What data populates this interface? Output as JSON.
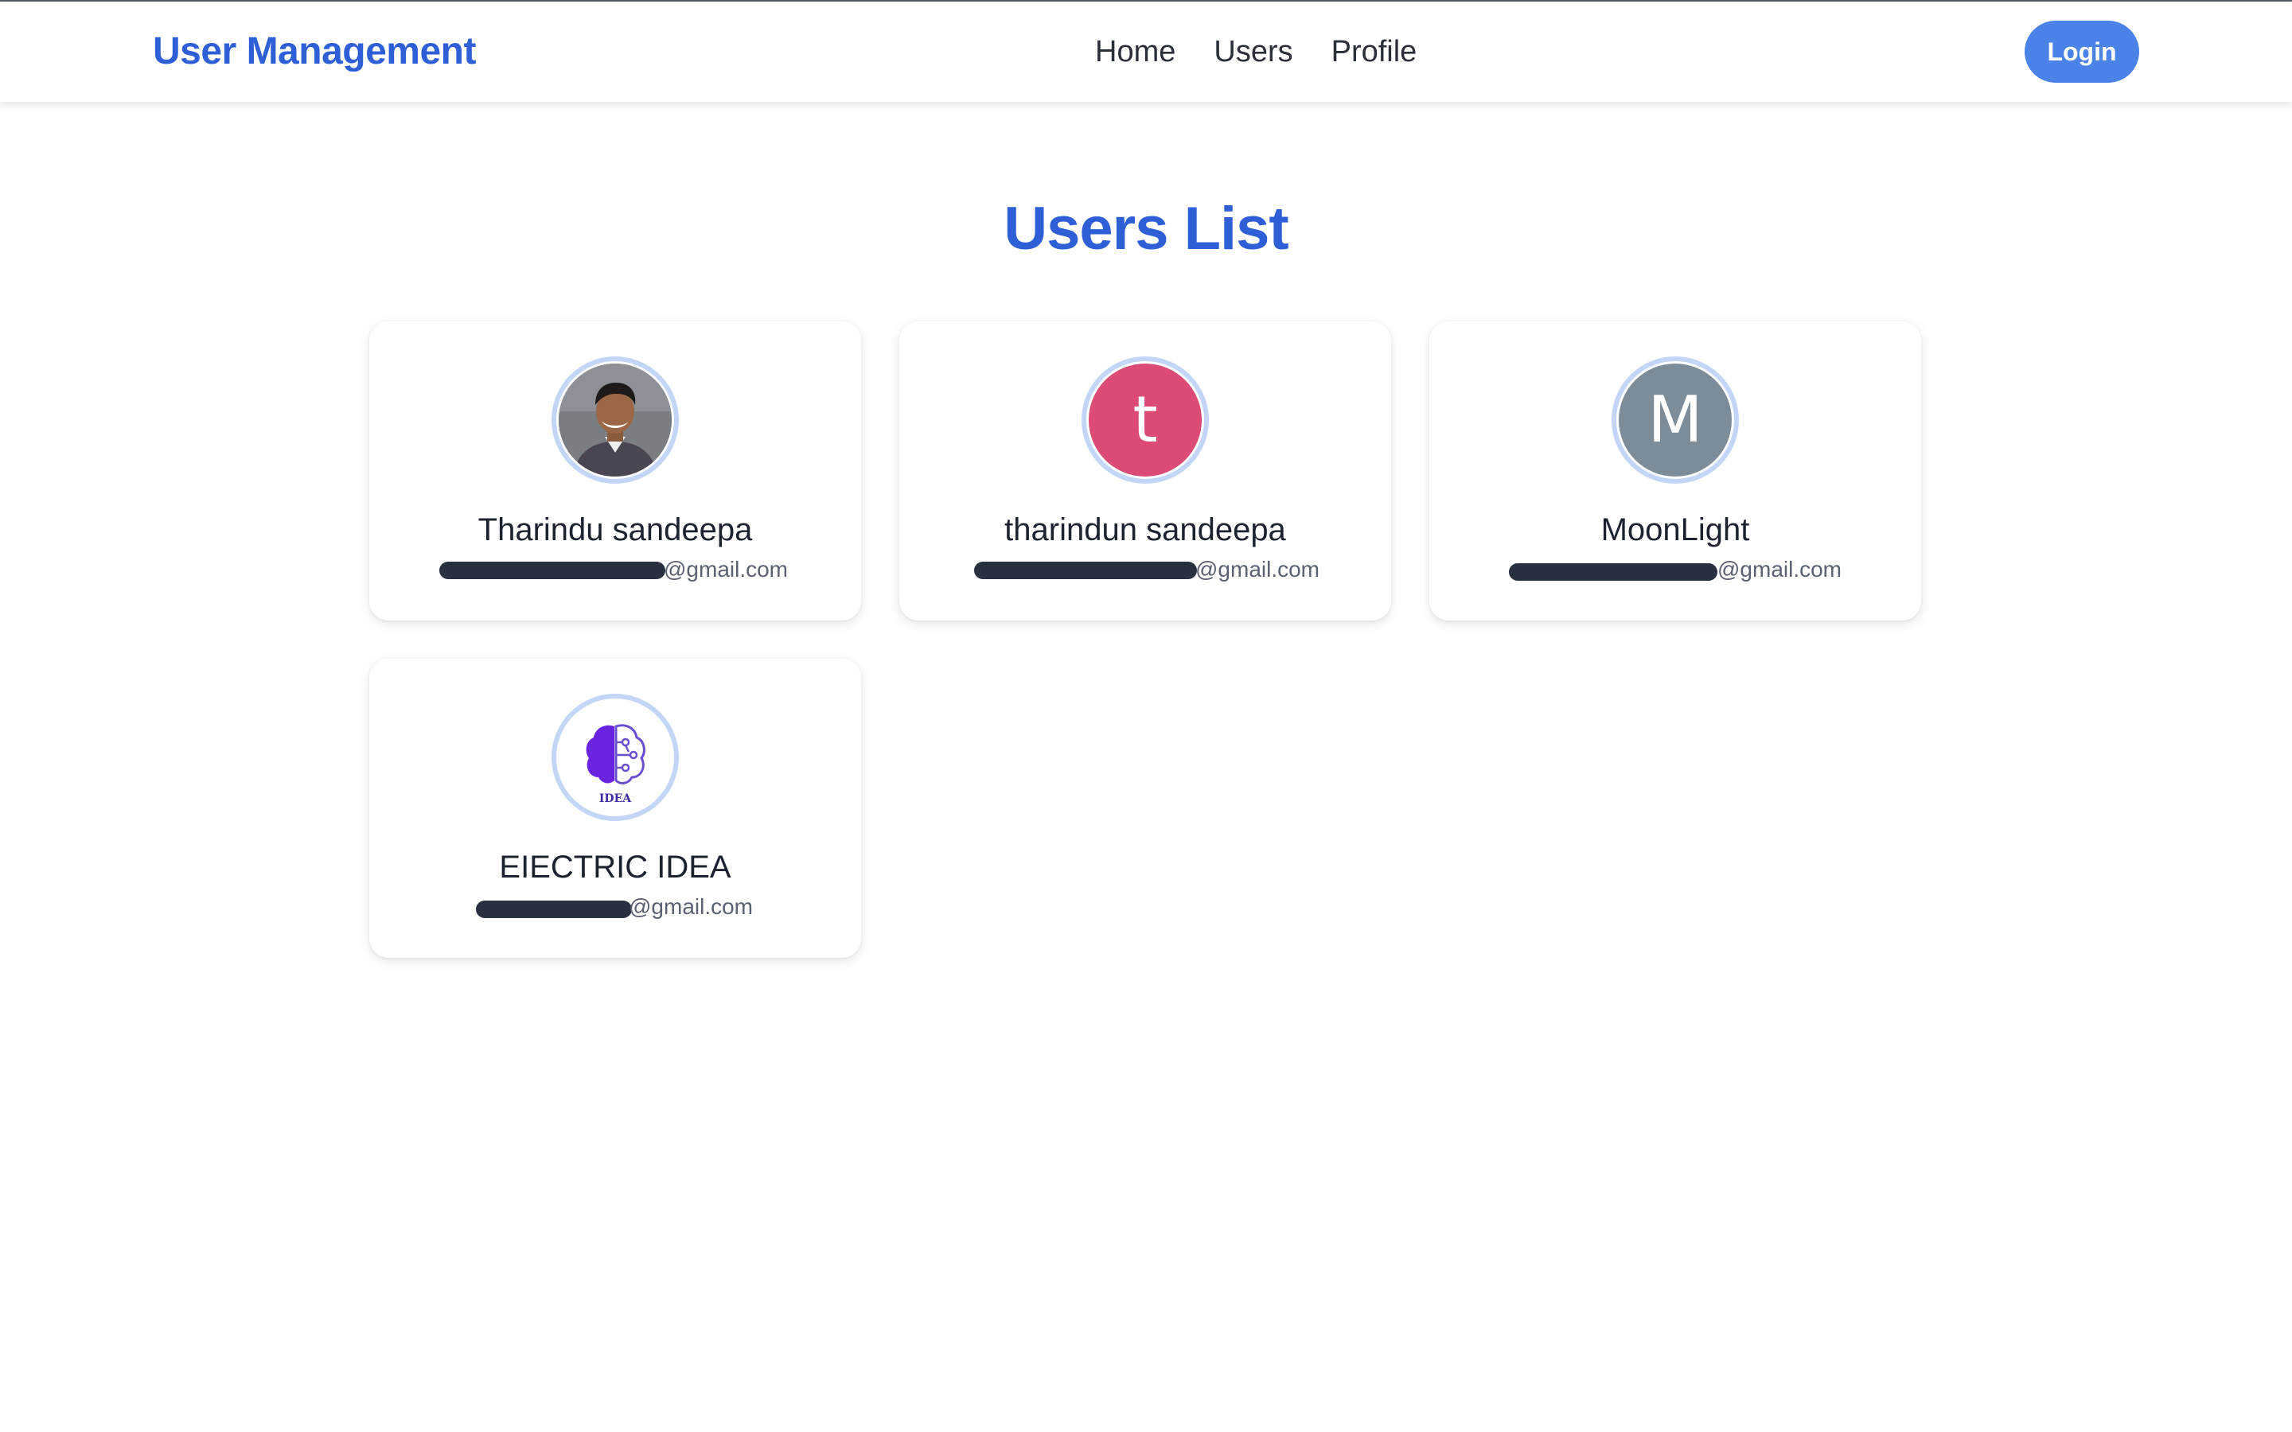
{
  "navbar": {
    "brand": "User Management",
    "links": [
      {
        "label": "Home"
      },
      {
        "label": "Users"
      },
      {
        "label": "Profile"
      }
    ],
    "login_label": "Login"
  },
  "main": {
    "title": "Users List"
  },
  "users": [
    {
      "name": "Tharindu sandeepa",
      "email_visible": "@gmail.com",
      "avatar": {
        "type": "photo",
        "icon": "person-photo"
      }
    },
    {
      "name": "tharindun sandeepa",
      "email_visible": "@gmail.com",
      "avatar": {
        "type": "letter",
        "letter": "t",
        "color": "#dc4a76"
      }
    },
    {
      "name": "MoonLight",
      "email_visible": "@gmail.com",
      "avatar": {
        "type": "letter",
        "letter": "M",
        "color": "#7d8c99"
      }
    },
    {
      "name": "EIECTRIC IDEA",
      "email_visible": "@gmail.com",
      "avatar": {
        "type": "logo",
        "icon": "brain-logo",
        "text": "IDEA"
      }
    }
  ],
  "colors": {
    "brand": "#2f5fd6",
    "login_button": "#4a82e8",
    "avatar_ring": "#c3d6f7"
  }
}
